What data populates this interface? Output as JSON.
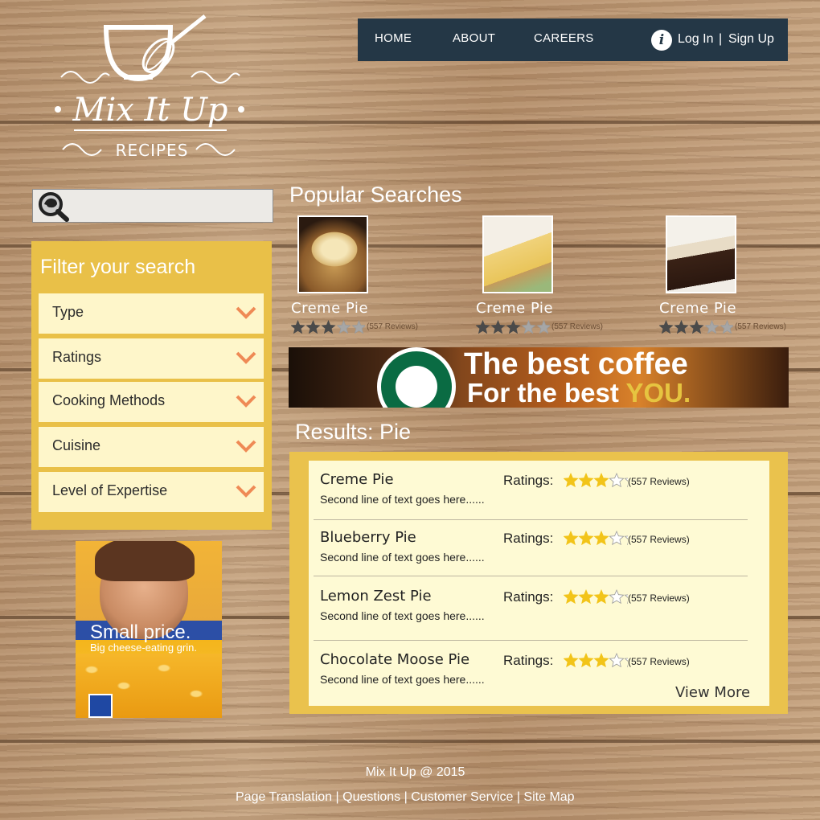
{
  "brand": {
    "name": "Mix It Up",
    "sub": "RECIPES"
  },
  "nav": {
    "home": "HOME",
    "about": "ABOUT",
    "careers": "CAREERS",
    "info_icon": "i",
    "login": "Log In",
    "separator": "|",
    "signup": "Sign Up"
  },
  "search": {
    "placeholder": ""
  },
  "filter": {
    "title": "Filter your search",
    "items": [
      {
        "label": "Type"
      },
      {
        "label": "Ratings"
      },
      {
        "label": "Cooking Methods"
      },
      {
        "label": "Cuisine"
      },
      {
        "label": "Level of Expertise"
      }
    ]
  },
  "ad_left": {
    "headline": "Small price.",
    "sub": "Big cheese-eating grin."
  },
  "popular": {
    "title": "Popular Searches",
    "items": [
      {
        "name": "Creme Pie",
        "rating": 3,
        "reviews": "(557 Reviews)"
      },
      {
        "name": "Creme Pie",
        "rating": 3,
        "reviews": "(557 Reviews)"
      },
      {
        "name": "Creme Pie",
        "rating": 3,
        "reviews": "(557 Reviews)"
      }
    ]
  },
  "banner": {
    "line1": "The best coffee",
    "line2": "For the best",
    "highlight": "YOU."
  },
  "results": {
    "title": "Results: Pie",
    "rating_label": "Ratings:",
    "items": [
      {
        "name": "Creme Pie",
        "sub": "Second line of text goes here......",
        "rating": 3,
        "reviews": "(557 Reviews)"
      },
      {
        "name": "Blueberry Pie",
        "sub": "Second line of text goes here......",
        "rating": 3,
        "reviews": "(557 Reviews)"
      },
      {
        "name": "Lemon Zest Pie",
        "sub": "Second line of text goes here......",
        "rating": 3,
        "reviews": "(557 Reviews)"
      },
      {
        "name": "Chocolate Moose Pie",
        "sub": "Second line of text goes here......",
        "rating": 3,
        "reviews": "(557 Reviews)"
      }
    ],
    "view_more": "View More"
  },
  "footer": {
    "copyright": "Mix It Up @ 2015",
    "links": [
      "Page Translation",
      "Questions",
      "Customer Service",
      "Site Map"
    ]
  },
  "colors": {
    "nav_bg": "#243746",
    "filter_bg": "#e9c048",
    "filter_item_bg": "#fef6ca",
    "chevron": "#ef8a55",
    "star_gold": "#f2c419",
    "star_dark": "#4a4a4a"
  }
}
